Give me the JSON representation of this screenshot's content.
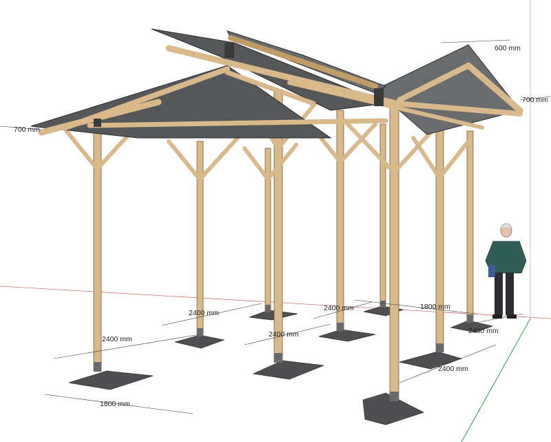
{
  "dimensions": {
    "overhang_left": "700 mm",
    "overhang_right": "700 mm",
    "ridge_gap": "600 mm",
    "bay_front": "2400 mm",
    "bay_middle_1": "2400 mm",
    "bay_middle_2": "2400 mm",
    "bay_back": "2400 mm",
    "width_front": "1800 mm",
    "width_back": "1800 mm",
    "bay_right_1": "2400 mm",
    "bay_right_2": "2400 mm"
  },
  "colors": {
    "wood": "#d9b98a",
    "roof": "#555759",
    "footing": "#4f4f52",
    "axis_red": "#c0392b",
    "axis_green": "#2e9e3e",
    "axis_blue": "#3b5bdb"
  }
}
